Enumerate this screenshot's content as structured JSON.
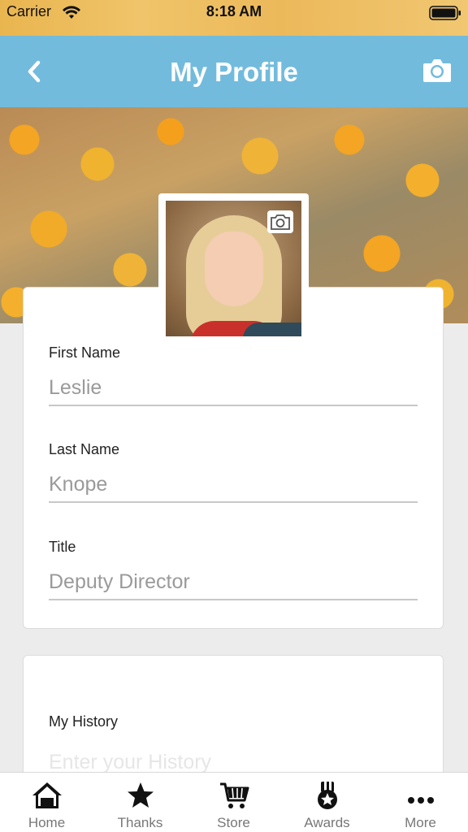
{
  "status_bar": {
    "carrier": "Carrier",
    "time": "8:18 AM"
  },
  "nav": {
    "title": "My Profile",
    "back_icon": "chevron-left-icon",
    "action_icon": "camera-icon"
  },
  "profile_fields": {
    "first_name": {
      "label": "First Name",
      "value": "Leslie"
    },
    "last_name": {
      "label": "Last Name",
      "value": "Knope"
    },
    "title": {
      "label": "Title",
      "value": "Deputy Director"
    }
  },
  "history": {
    "label": "My History",
    "placeholder": "Enter your History"
  },
  "tabbar": {
    "items": [
      {
        "label": "Home",
        "icon": "home-icon"
      },
      {
        "label": "Thanks",
        "icon": "star-icon"
      },
      {
        "label": "Store",
        "icon": "cart-icon"
      },
      {
        "label": "Awards",
        "icon": "medal-icon"
      },
      {
        "label": "More",
        "icon": "more-icon"
      }
    ]
  },
  "colors": {
    "nav_bg": "#72bbdd",
    "tab_icon": "#111111",
    "label_gray": "#777777"
  }
}
